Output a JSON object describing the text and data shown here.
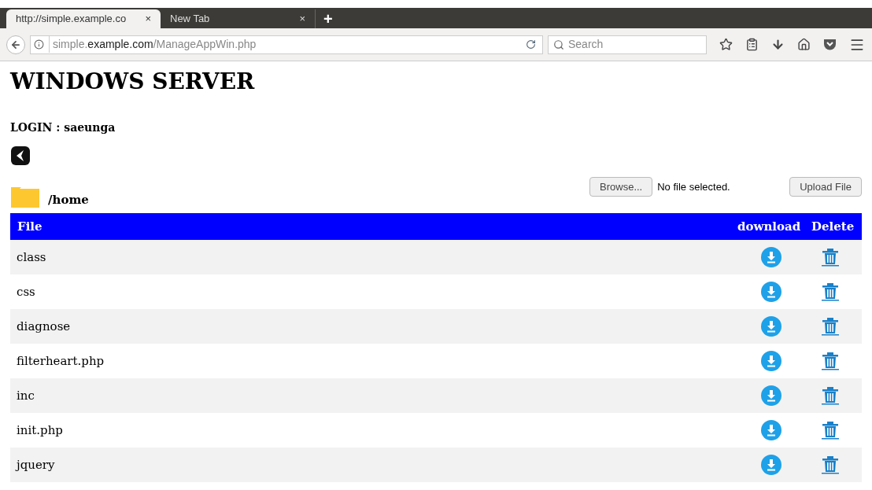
{
  "browser": {
    "tabs": [
      {
        "title": "http://simple.example.co",
        "close": "×",
        "selected": true
      },
      {
        "title": "New Tab",
        "close": "×",
        "selected": false
      }
    ],
    "new_tab": "+",
    "address": {
      "subdomain": "simple.",
      "domain": "example.com",
      "path": "/ManageAppWin.php"
    },
    "search": {
      "placeholder": "Search"
    }
  },
  "page": {
    "title": "WINDOWS SERVER",
    "login": "LOGIN : saeunga",
    "folder": "/home",
    "upload": {
      "browse": "Browse...",
      "status": "No file selected.",
      "submit": "Upload File"
    },
    "table": {
      "columns": [
        "File",
        "download",
        "Delete"
      ],
      "rows": [
        {
          "name": "class"
        },
        {
          "name": "css"
        },
        {
          "name": "diagnose"
        },
        {
          "name": "filterheart.php"
        },
        {
          "name": "inc"
        },
        {
          "name": "init.php"
        },
        {
          "name": "jquery"
        }
      ]
    }
  }
}
